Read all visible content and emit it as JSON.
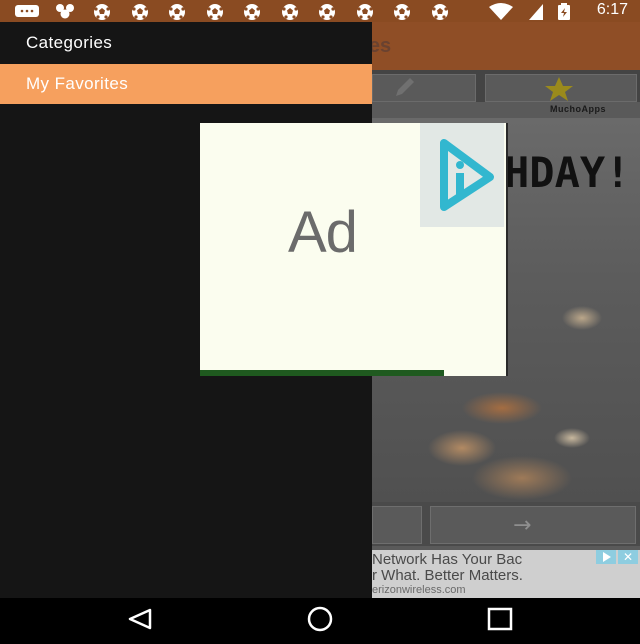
{
  "status_bar": {
    "time": "6:17",
    "icons": [
      "chat-icon",
      "people-icon",
      "soccer-ball-icon",
      "soccer-ball-icon",
      "soccer-ball-icon",
      "soccer-ball-icon",
      "soccer-ball-icon",
      "soccer-ball-icon",
      "soccer-ball-icon",
      "soccer-ball-icon",
      "soccer-ball-icon",
      "soccer-ball-icon",
      "wifi-icon",
      "sim-icon",
      "battery-icon"
    ]
  },
  "app": {
    "title_visible": "otes",
    "brand": "MuchoApps",
    "photo_text": "HDAY!",
    "nav_next": "→",
    "banner": {
      "line1": "Network Has Your Bac",
      "line2": "r What. Better Matters.",
      "line3": "erizonwireless.com"
    },
    "colors": {
      "appbar": "#8f4e26",
      "statusbar": "#8a4b22"
    }
  },
  "drawer": {
    "items": [
      {
        "label": "Categories",
        "selected": false
      },
      {
        "label": "My Favorites",
        "selected": true
      }
    ],
    "colors": {
      "background": "#151515",
      "selected": "#f6a05e"
    }
  },
  "ad": {
    "label": "Ad",
    "icon": "play-logo-icon"
  },
  "system_nav": {
    "buttons": [
      "back-icon",
      "home-icon",
      "recents-icon"
    ]
  }
}
